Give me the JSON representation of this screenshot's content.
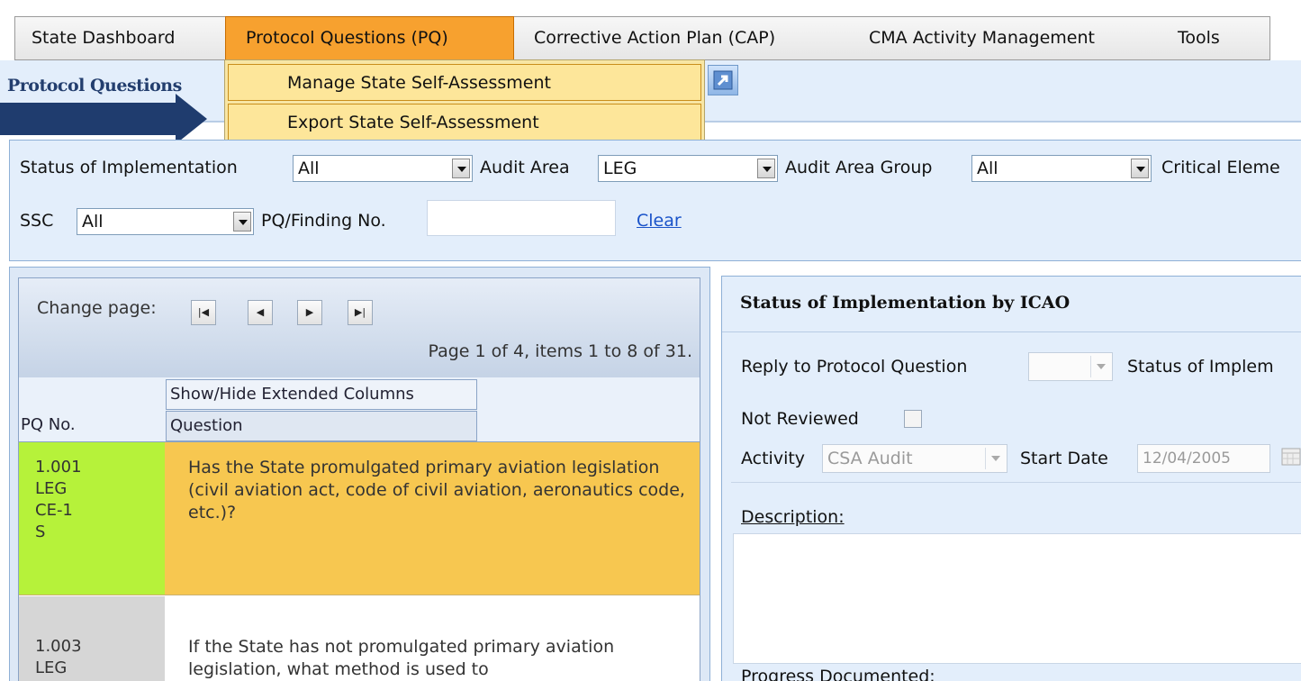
{
  "menu": {
    "items": [
      {
        "label": "State Dashboard"
      },
      {
        "label": "Protocol Questions (PQ)"
      },
      {
        "label": "Corrective Action Plan (CAP)"
      },
      {
        "label": "CMA Activity Management"
      },
      {
        "label": "Tools"
      }
    ],
    "active_index": 1,
    "dropdown": [
      {
        "label": "Manage State Self-Assessment"
      },
      {
        "label": "Export State Self-Assessment"
      }
    ]
  },
  "page": {
    "title": "Protocol Questions"
  },
  "filters": {
    "status_label": "Status of Implementation",
    "status_value": "All",
    "audit_area_label": "Audit Area",
    "audit_area_value": "LEG",
    "audit_area_group_label": "Audit Area Group",
    "audit_area_group_value": "All",
    "critical_element_label": "Critical Eleme",
    "ssc_label": "SSC",
    "ssc_value": "All",
    "pq_finding_label": "PQ/Finding No.",
    "pq_finding_value": "",
    "clear_label": "Clear"
  },
  "grid": {
    "change_page_label": "Change page:",
    "page_info": "Page 1 of 4, items 1 to 8 of 31.",
    "show_hide_label": "Show/Hide Extended Columns",
    "col_pq": "PQ No.",
    "col_question": "Question",
    "rows": [
      {
        "pq_no": "1.001",
        "area": "LEG",
        "ce": "CE-1",
        "status": "S",
        "question": "Has the State promulgated primary aviation legislation (civil aviation act, code of civil aviation, aeronautics code, etc.)?"
      },
      {
        "pq_no": "1.003",
        "area": "LEG",
        "question": "If the State has not promulgated primary aviation legislation, what method is used to"
      }
    ]
  },
  "details": {
    "title": "Status of Implementation by ICAO",
    "reply_label": "Reply to Protocol Question",
    "status_label": "Status of Implem",
    "not_reviewed_label": "Not Reviewed",
    "activity_label": "Activity",
    "activity_value": "CSA Audit",
    "start_date_label": "Start Date",
    "start_date_value": "12/04/2005",
    "description_label": "Description:",
    "progress_label": "Progress Documented:"
  },
  "colors": {
    "menu_active": "#f7a12f",
    "dropdown_bg": "#fde69a",
    "row_selected_id": "#b6f23a",
    "row_selected_q": "#f7c750",
    "arrow": "#1f3c6e",
    "link": "#1a53c9"
  }
}
